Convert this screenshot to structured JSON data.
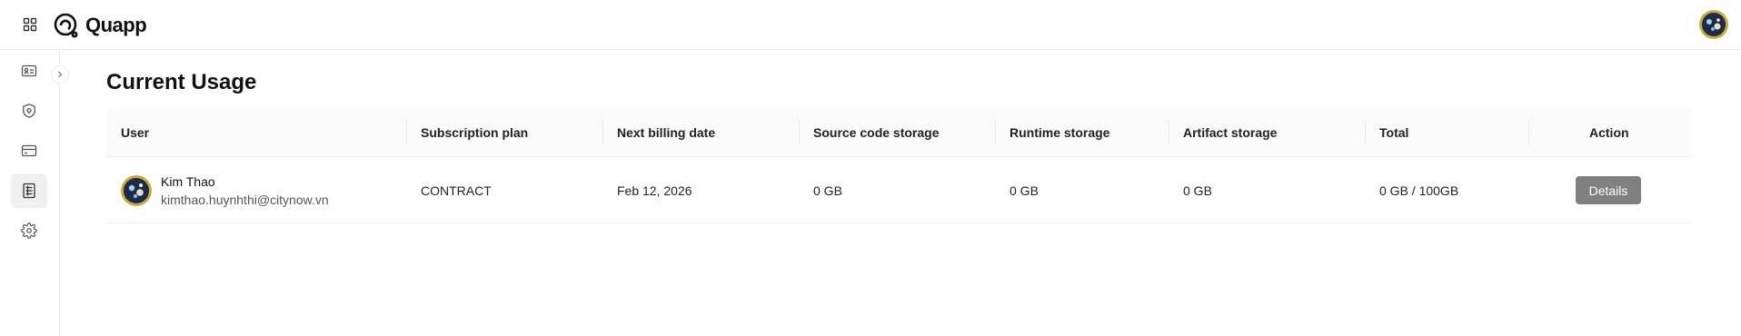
{
  "app": {
    "name": "Quapp"
  },
  "header": {
    "apps_icon": "grid-icon",
    "avatar_icon": "user-avatar"
  },
  "sidebar": {
    "items": [
      {
        "icon": "id-card-icon",
        "active": false
      },
      {
        "icon": "shield-icon",
        "active": false
      },
      {
        "icon": "credit-card-icon",
        "active": false
      },
      {
        "icon": "usage-list-icon",
        "active": true
      },
      {
        "icon": "gear-icon",
        "active": false
      }
    ],
    "collapse_icon": "chevron-right-icon"
  },
  "page": {
    "title": "Current Usage"
  },
  "table": {
    "columns": {
      "user": "User",
      "plan": "Subscription plan",
      "billing": "Next billing date",
      "source": "Source code storage",
      "runtime": "Runtime storage",
      "artifact": "Artifact storage",
      "total": "Total",
      "action": "Action"
    },
    "rows": [
      {
        "name": "Kim Thao",
        "email": "kimthao.huynhthi@citynow.vn",
        "plan": "CONTRACT",
        "billing": "Feb 12, 2026",
        "source": "0 GB",
        "runtime": "0 GB",
        "artifact": "0 GB",
        "total": "0 GB / 100GB",
        "action": "Details"
      }
    ]
  },
  "colors": {
    "accent_button": "#808080",
    "header_bg": "#fafafa",
    "active_nav": "#f0f0f0"
  }
}
